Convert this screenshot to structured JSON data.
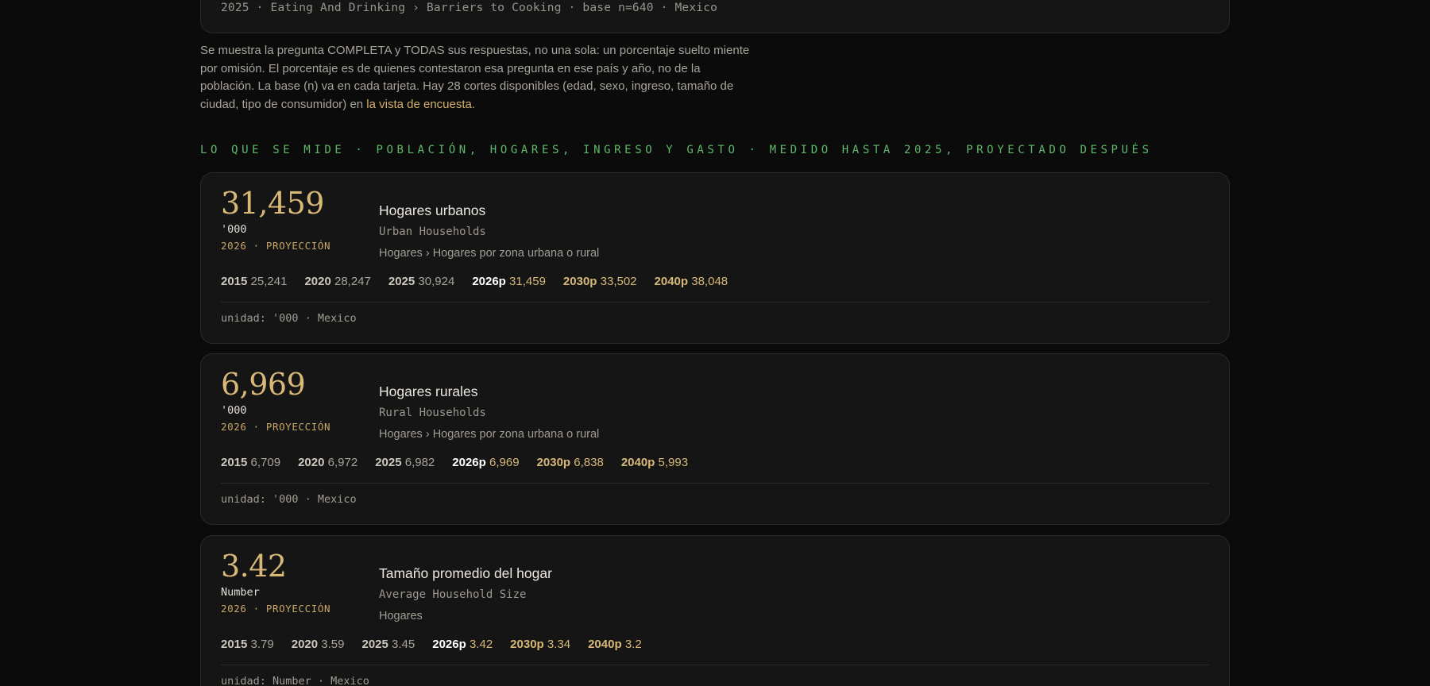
{
  "top_card": {
    "breadcrumb": "2025 · Eating And Drinking › Barriers to Cooking · base n=640 · Mexico"
  },
  "note": {
    "text_before_link": "Se muestra la pregunta COMPLETA y TODAS sus respuestas, no una sola: un porcentaje suelto miente por omisión. El porcentaje es de quienes contestaron esa pregunta en ese país y año, no de la población. La base (n) va en cada tarjeta. Hay 28 cortes disponibles (edad, sexo, ingreso, tamaño de ciudad, tipo de consumidor) en ",
    "link": "la vista de encuesta",
    "text_after_link": "."
  },
  "section": {
    "label": "LO QUE SE MIDE · POBLACIÓN, HOGARES, INGRESO Y GASTO · MEDIDO HASTA 2025, PROYECTADO DESPUÉS"
  },
  "metrics": [
    {
      "value": "31,459",
      "unit": "'000",
      "projection": "2026 · PROYECCIÓN",
      "title_es": "Hogares urbanos",
      "title_en": "Urban Households",
      "path": "Hogares › Hogares por zona urbana o rural",
      "years": [
        {
          "year": "2015",
          "value": "25,241"
        },
        {
          "year": "2020",
          "value": "28,247"
        },
        {
          "year": "2025",
          "value": "30,924"
        },
        {
          "year": "2026p",
          "value": "31,459"
        },
        {
          "year": "2030p",
          "value": "33,502"
        },
        {
          "year": "2040p",
          "value": "38,048"
        }
      ],
      "footer": "unidad: '000 · Mexico"
    },
    {
      "value": "6,969",
      "unit": "'000",
      "projection": "2026 · PROYECCIÓN",
      "title_es": "Hogares rurales",
      "title_en": "Rural Households",
      "path": "Hogares › Hogares por zona urbana o rural",
      "years": [
        {
          "year": "2015",
          "value": "6,709"
        },
        {
          "year": "2020",
          "value": "6,972"
        },
        {
          "year": "2025",
          "value": "6,982"
        },
        {
          "year": "2026p",
          "value": "6,969"
        },
        {
          "year": "2030p",
          "value": "6,838"
        },
        {
          "year": "2040p",
          "value": "5,993"
        }
      ],
      "footer": "unidad: '000 · Mexico"
    },
    {
      "value": "3.42",
      "unit": "Number",
      "projection": "2026 · PROYECCIÓN",
      "title_es": "Tamaño promedio del hogar",
      "title_en": "Average Household Size",
      "path": "Hogares",
      "years": [
        {
          "year": "2015",
          "value": "3.79"
        },
        {
          "year": "2020",
          "value": "3.59"
        },
        {
          "year": "2025",
          "value": "3.45"
        },
        {
          "year": "2026p",
          "value": "3.42"
        },
        {
          "year": "2030p",
          "value": "3.34"
        },
        {
          "year": "2040p",
          "value": "3.2"
        }
      ],
      "footer": "unidad: Number · Mexico"
    }
  ],
  "colors": {
    "background": "#0b0b0b",
    "card": "#151515",
    "accent_gold": "#d8b877",
    "section_green": "#5fb96a"
  }
}
